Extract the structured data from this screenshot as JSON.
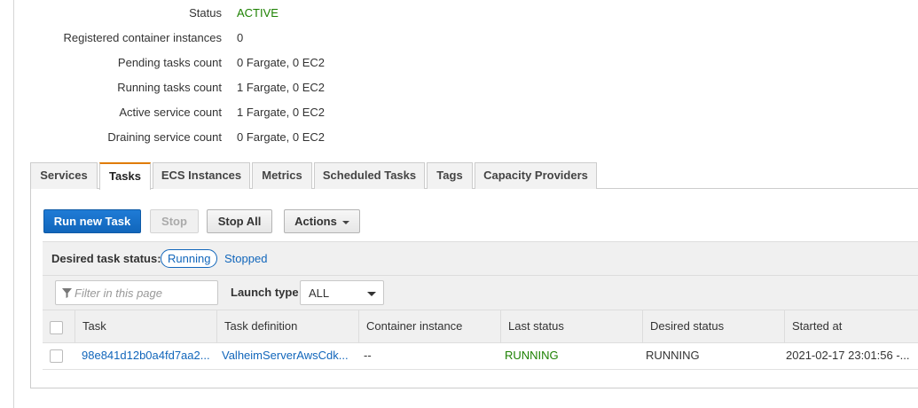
{
  "summary": {
    "status_label": "Status",
    "status_value": "ACTIVE",
    "registered_label": "Registered container instances",
    "registered_value": "0",
    "pending_label": "Pending tasks count",
    "pending_value": "0 Fargate, 0 EC2",
    "running_label": "Running tasks count",
    "running_value": "1 Fargate, 0 EC2",
    "active_service_label": "Active service count",
    "active_service_value": "1 Fargate, 0 EC2",
    "draining_label": "Draining service count",
    "draining_value": "0 Fargate, 0 EC2"
  },
  "tabs": [
    "Services",
    "Tasks",
    "ECS Instances",
    "Metrics",
    "Scheduled Tasks",
    "Tags",
    "Capacity Providers"
  ],
  "selected_tab": "Tasks",
  "toolbar": {
    "run_new_task": "Run new Task",
    "stop": "Stop",
    "stop_all": "Stop All",
    "actions": "Actions"
  },
  "status_filter": {
    "label": "Desired task status:",
    "running": "Running",
    "stopped": "Stopped"
  },
  "filter": {
    "placeholder": "Filter in this page",
    "launch_type_label": "Launch type",
    "launch_type_value": "ALL"
  },
  "table": {
    "columns": [
      "Task",
      "Task definition",
      "Container instance",
      "Last status",
      "Desired status",
      "Started at"
    ],
    "rows": [
      {
        "task": "98e841d12b0a4fd7aa2...",
        "task_definition": "ValheimServerAwsCdk...",
        "container_instance": "--",
        "last_status": "RUNNING",
        "desired_status": "RUNNING",
        "started_at": "2021-02-17 23:01:56 -..."
      }
    ]
  },
  "colors": {
    "accent_blue": "#1166bb",
    "status_green": "#1d8102",
    "tab_selected_top": "#e07b00"
  }
}
